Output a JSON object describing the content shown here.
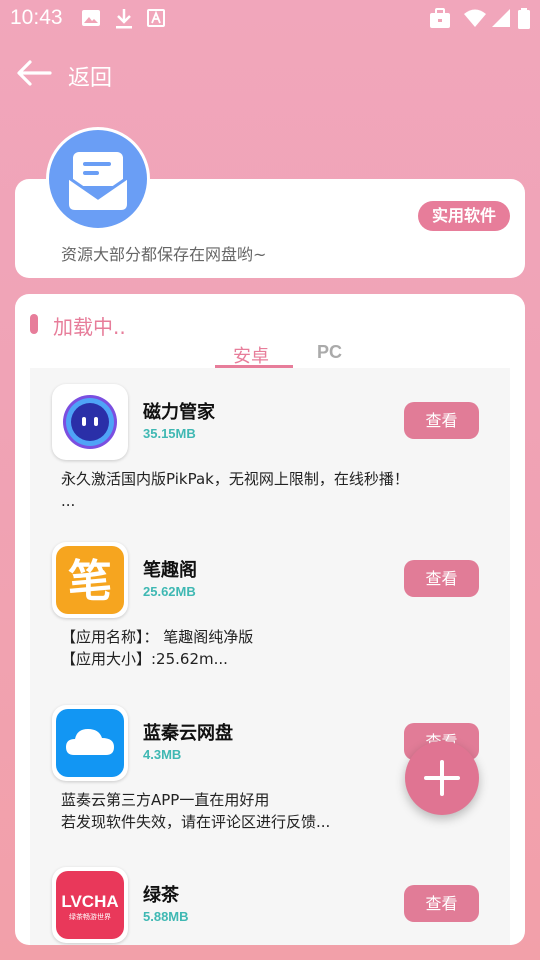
{
  "status_bar": {
    "time": "10:43",
    "icons": [
      "image-icon",
      "download-icon",
      "font-icon",
      "briefcase-icon",
      "wifi-icon",
      "signal-icon",
      "battery-icon"
    ]
  },
  "app_bar": {
    "back_label": "返回"
  },
  "info_card": {
    "tag": "实用软件",
    "description": "资源大部分都保存在网盘哟~",
    "avatar_icon": "mail-icon",
    "accent": "#e77d9a",
    "avatar_color": "#6a9ef5"
  },
  "list_section": {
    "loading_text": "加载中..",
    "tabs": [
      {
        "label": "安卓",
        "active": true
      },
      {
        "label": "PC",
        "active": false
      }
    ]
  },
  "apps": [
    {
      "name": "磁力管家",
      "size": "35.15MB",
      "button": "查看",
      "description": "永久激活国内版PikPak，无视网上限制，在线秒播！\n...",
      "icon": "pikpak-robot-icon"
    },
    {
      "name": "笔趣阁",
      "size": "25.62MB",
      "button": "查看",
      "description": "【应用名称】： 笔趣阁纯净版\n【应用大小】:25.62m...",
      "icon": "biquge-icon",
      "icon_text": "笔"
    },
    {
      "name": "蓝秦云网盘",
      "size": "4.3MB",
      "button": "查看",
      "description": "蓝奏云第三方APP一直在用好用\n若发现软件失效，请在评论区进行反馈...",
      "icon": "cloud-icon"
    },
    {
      "name": "绿茶",
      "size": "5.88MB",
      "button": "查看",
      "description": "",
      "icon": "lvcha-icon",
      "icon_text": "LVCHA",
      "icon_subtext": "绿茶畅游世界"
    }
  ],
  "fab": {
    "icon": "plus-icon"
  }
}
